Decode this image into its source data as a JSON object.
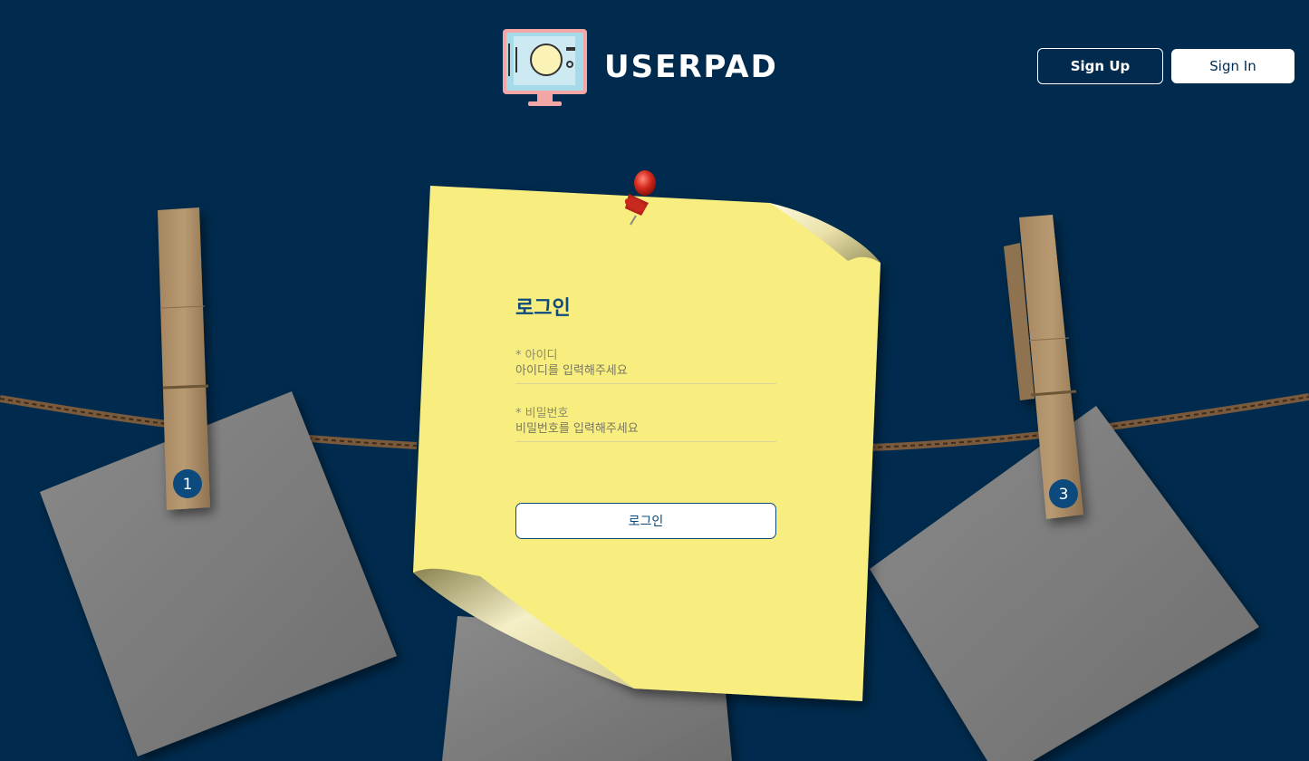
{
  "header": {
    "logo_text": "USERPAD",
    "logo_icon": "monitor-logo-icon",
    "signup_label": "Sign Up",
    "signin_label": "Sign In"
  },
  "background": {
    "notes": [
      {
        "pin_number": "1"
      },
      {
        "pin_number": "3"
      }
    ]
  },
  "login": {
    "title": "로그인",
    "id_label": "* 아이디",
    "id_placeholder": "아이디를 입력해주세요",
    "password_label": "* 비밀번호",
    "password_placeholder": "비밀번호를 입력해주세요",
    "submit_label": "로그인"
  },
  "colors": {
    "background": "#002b4e",
    "sticky_note": "#f8ee80",
    "accent": "#0c4a7e",
    "pin": "#d32f2f"
  }
}
